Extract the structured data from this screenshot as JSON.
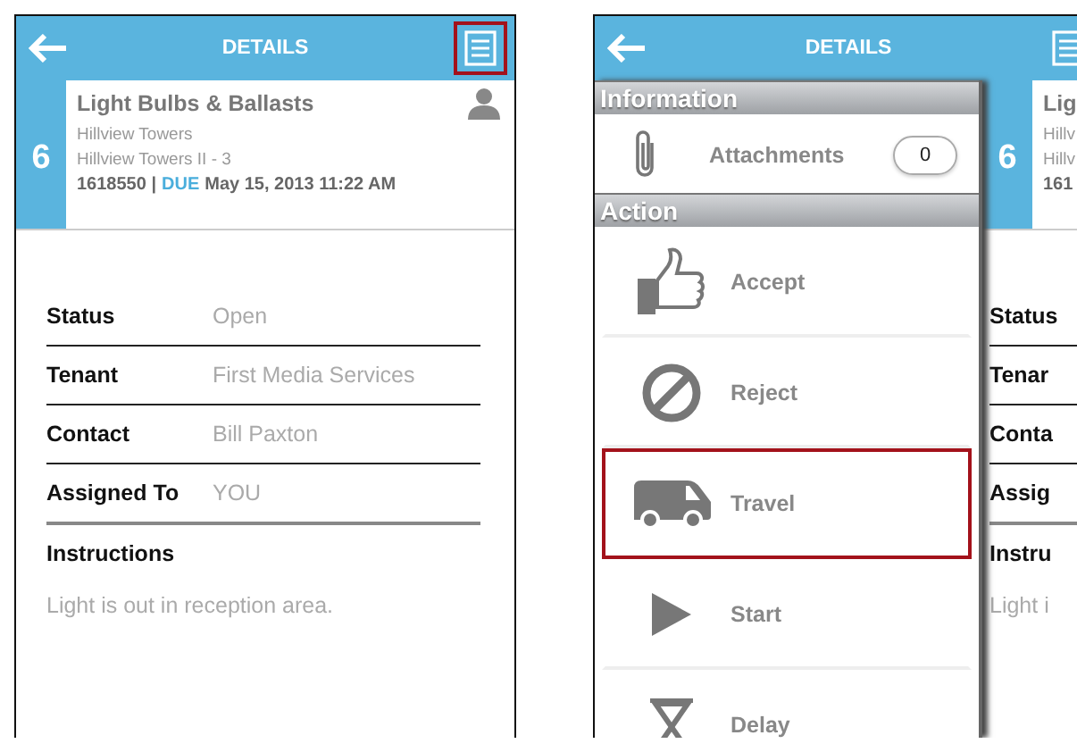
{
  "screens": [
    {
      "kind": "details",
      "header": {
        "title": "DETAILS",
        "menu_highlighted": true
      },
      "work_order": {
        "number": "6",
        "title": "Light Bulbs & Ballasts",
        "building": "Hillview Towers",
        "location": "Hillview Towers II - 3",
        "reference": "1618550 |",
        "due_label": "DUE",
        "due_date": "May 15, 2013 11:22 AM"
      },
      "fields": [
        {
          "label": "Status",
          "value": "Open"
        },
        {
          "label": "Tenant",
          "value": "First Media Services"
        },
        {
          "label": "Contact",
          "value": "Bill Paxton"
        },
        {
          "label": "Assigned To",
          "value": "YOU"
        }
      ],
      "instructions": {
        "label": "Instructions",
        "text": "Light is out in reception area."
      }
    },
    {
      "kind": "menu",
      "header": {
        "title": "DETAILS",
        "menu_highlighted": false
      },
      "sections": [
        {
          "title": "Information",
          "items": [
            {
              "kind": "attachment",
              "label": "Attachments",
              "count": "0",
              "highlighted": false
            }
          ]
        },
        {
          "title": "Action",
          "items": [
            {
              "kind": "accept",
              "label": "Accept",
              "highlighted": false
            },
            {
              "kind": "reject",
              "label": "Reject",
              "highlighted": false
            },
            {
              "kind": "travel",
              "label": "Travel",
              "highlighted": true
            },
            {
              "kind": "start",
              "label": "Start",
              "highlighted": false
            },
            {
              "kind": "delay",
              "label": "Delay",
              "highlighted": false
            }
          ]
        }
      ],
      "peek": {
        "number": "6",
        "title": "Lig",
        "building": "Hillv",
        "location": "Hillv",
        "reference": "161",
        "labels": [
          "Status",
          "Tenar",
          "Conta",
          "Assig",
          "Instru"
        ],
        "instructions_text": "Light i"
      }
    }
  ]
}
